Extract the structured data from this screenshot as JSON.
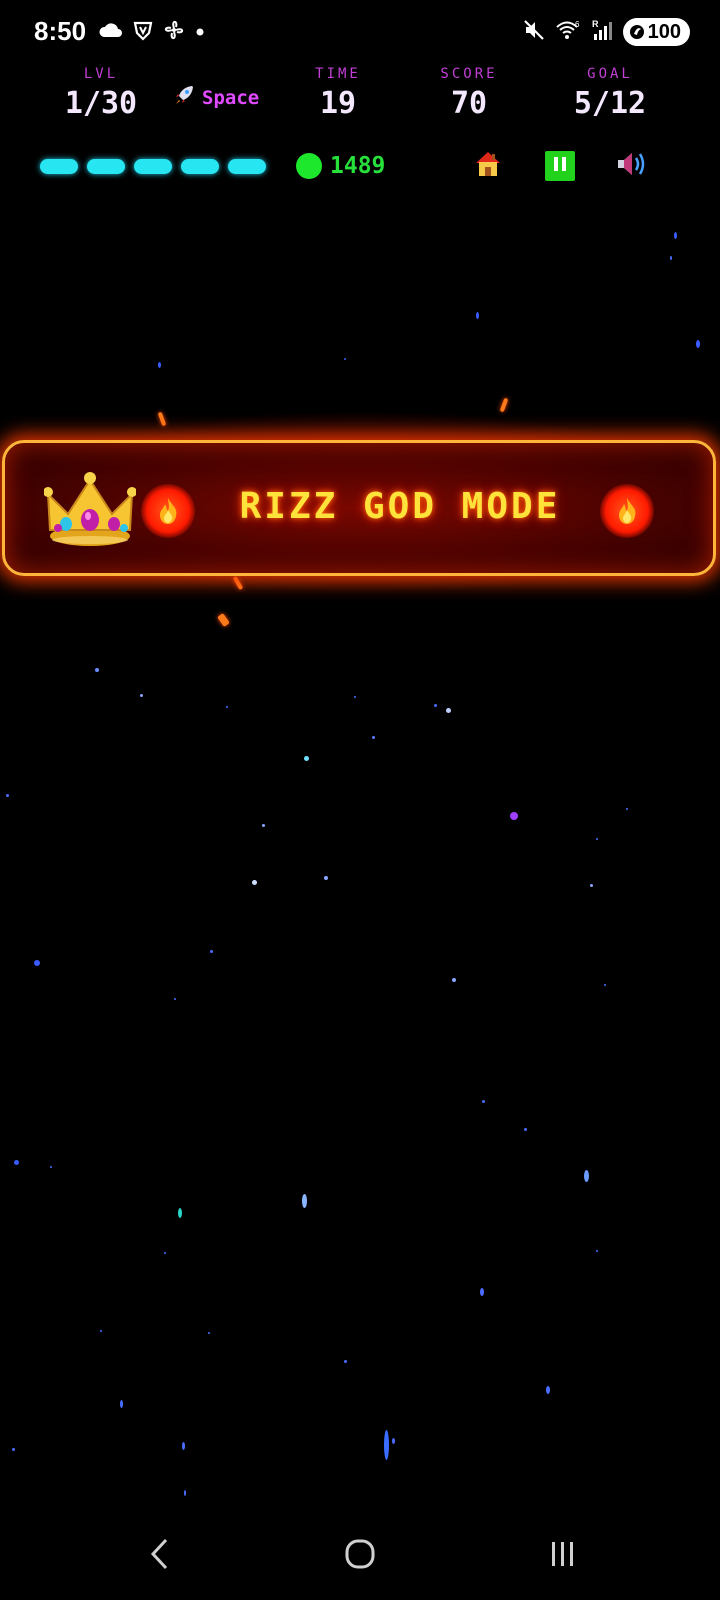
{
  "status_bar": {
    "time": "8:50",
    "battery": "100",
    "left_icons": [
      "cloud-icon",
      "vpn-shield-icon",
      "fan-icon",
      "dot-icon"
    ],
    "right_icons": [
      "mute-icon",
      "wifi-icon",
      "signal-icon",
      "battery-icon"
    ]
  },
  "hud": {
    "level": {
      "label": "LVL",
      "value": "1/30"
    },
    "world": {
      "icon": "rocket-icon",
      "name": "Space"
    },
    "time": {
      "label": "TIME",
      "value": "19"
    },
    "score": {
      "label": "SCORE",
      "value": "70"
    },
    "goal": {
      "label": "GOAL",
      "value": "5/12"
    },
    "lives": 5,
    "coins": "1489",
    "buttons": [
      "home-icon",
      "pause-icon",
      "speaker-icon"
    ]
  },
  "banner": {
    "text": "RIZZ GOD MODE",
    "left_icon": "crown-icon",
    "side_icons": [
      "fire-icon",
      "fire-icon"
    ]
  },
  "colors": {
    "label": "#c23fd6",
    "life": "#27e6f2",
    "coin": "#1de82c",
    "banner_text": "#ffe23a",
    "banner_border": "#ffb53a",
    "world": "#e04bff"
  },
  "nav_bar": {
    "buttons": [
      "back-icon",
      "home-circle-icon",
      "recents-icon"
    ]
  }
}
